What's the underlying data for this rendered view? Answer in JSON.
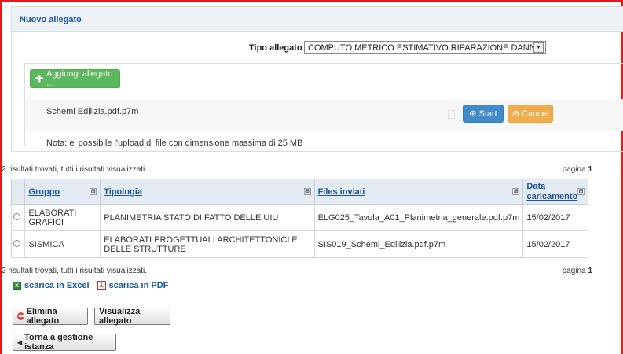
{
  "panel": {
    "title": "Nuovo allegato",
    "type_label": "Tipo allegato",
    "type_value": "COMPUTO METRICO ESTIMATIVO RIPARAZIONE DANNI"
  },
  "upload": {
    "add_label": "Aggiungi allegato ...",
    "file_name": "Schemi Edilizia.pdf.p7m",
    "start_label": "Start",
    "cancel_label": "Cancel",
    "note": "Nota: e' possibile l'upload di file con dimensione massima di 25 MB"
  },
  "results": {
    "summary": "2 risultati trovati, tutti i risultati visualizzati.",
    "page_label": "pagina",
    "page_number": "1"
  },
  "table": {
    "headers": {
      "gruppo": "Gruppo",
      "tipologia": "Tipologia",
      "files": "Files inviati",
      "data": "Data caricamento"
    },
    "rows": [
      {
        "gruppo": "ELABORATI GRAFICI",
        "tipologia": "PLANIMETRIA STATO DI FATTO DELLE UIU",
        "file": "ELG025_Tavola_A01_Planimetria_generale.pdf.p7m",
        "data": "15/02/2017"
      },
      {
        "gruppo": "SISMICA",
        "tipologia": "ELABORATI PROGETTUALI ARCHITETTONICI E DELLE STRUTTURE",
        "file": "SIS019_Schemi_Edilizia.pdf.p7m",
        "data": "15/02/2017"
      }
    ]
  },
  "export": {
    "excel": "scarica in Excel",
    "pdf": "scarica in PDF"
  },
  "actions": {
    "delete": "Elimina allegato",
    "view": "Visualizza allegato",
    "back": "Torna a gestione istanza"
  },
  "colors": {
    "frame": "#e8191b",
    "link": "#1a56a6",
    "add_button": "#5cb85c",
    "start_button": "#428bca",
    "cancel_button": "#f0ad4e"
  },
  "icons": [
    "plus-icon",
    "upload-icon",
    "cancel-icon",
    "sort-icon",
    "radio-icon",
    "excel-icon",
    "pdf-icon",
    "delete-icon",
    "back-arrow-icon"
  ]
}
